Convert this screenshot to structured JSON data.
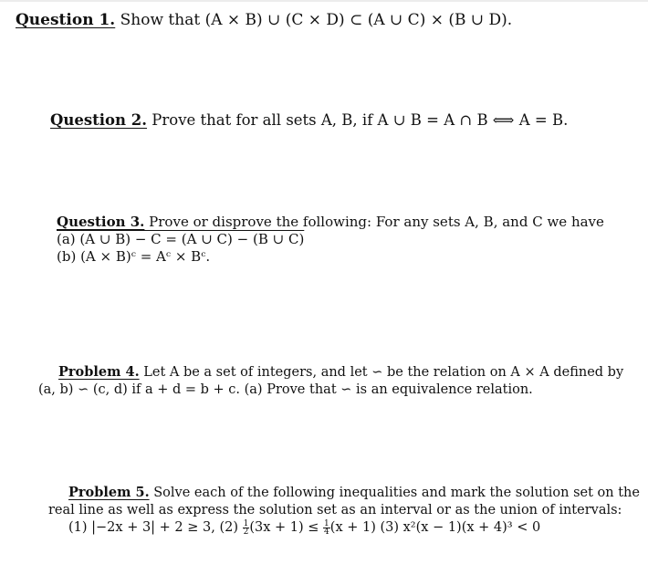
{
  "questions": [
    {
      "label": "Question 1.",
      "lines": [
        "Show that (A × B) ∪ (C × D) ⊂ (A ∪ C) × (B ∪ D)."
      ]
    },
    {
      "label": "Question 2.",
      "lines": [
        "Prove that for all sets A, B, if A ∪ B = A ∩ B ⟺ A = B."
      ]
    },
    {
      "label": "Question 3.",
      "lines": [
        "Prove or disprove the following: For any sets A, B,  and C we have",
        "(a) (A ∪ B) − C = (A ∪ C) − (B ∪ C)",
        "(b) (A × B)ᶜ = Aᶜ × Bᶜ."
      ]
    },
    {
      "label": "Problem 4.",
      "lines": [
        "Let A be a set of integers, and let ∽ be the relation on A × A defined by",
        "(a, b) ∽ (c, d) if a + d = b + c. (a) Prove that ∽ is an equivalence relation."
      ]
    },
    {
      "label": "Problem 5.",
      "lines": [
        "Solve each of the following inequalities and mark the solution set on the",
        "real line as well as express the solution set as an interval or as the union of intervals:"
      ],
      "items": {
        "item1": "(1) |−2x + 3| + 2 ≥ 3,",
        "item2_prefix": "(2)",
        "item2_frac1_num": "1",
        "item2_frac1_den": "2",
        "item2_mid": "(3x + 1) ≤",
        "item2_frac2_num": "1",
        "item2_frac2_den": "4",
        "item2_end": "(x + 1)",
        "item3": "(3) x²(x − 1)(x + 4)³ < 0"
      }
    }
  ]
}
